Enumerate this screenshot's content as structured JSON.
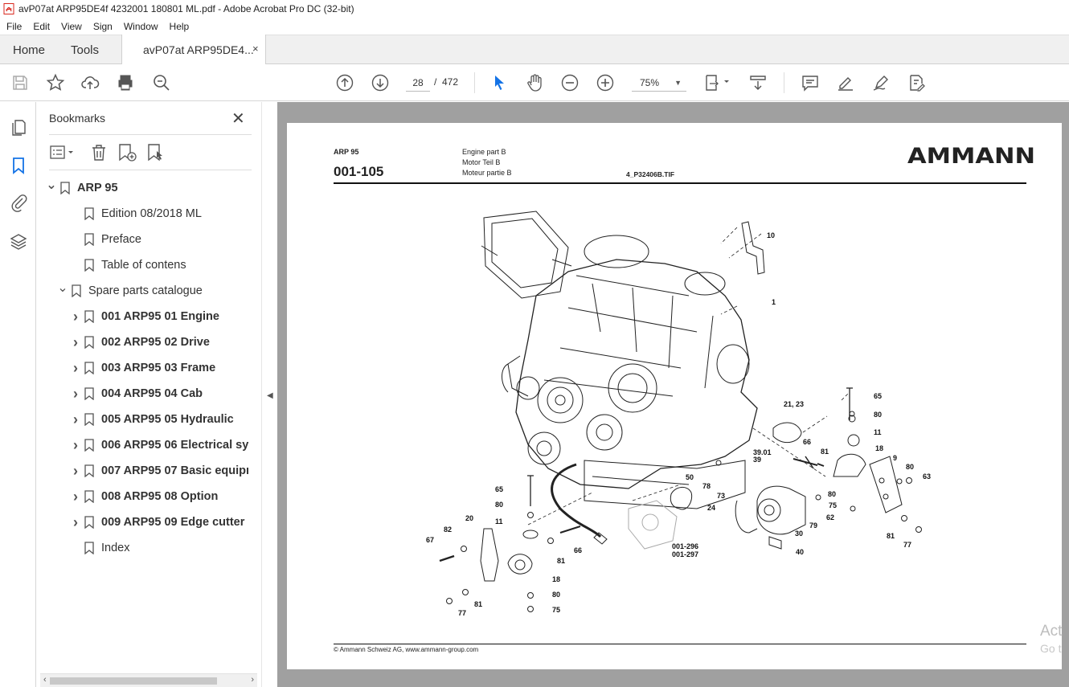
{
  "window": {
    "title": "avP07at ARP95DE4f 4232001 180801 ML.pdf - Adobe Acrobat Pro DC (32-bit)"
  },
  "menu": [
    "File",
    "Edit",
    "View",
    "Sign",
    "Window",
    "Help"
  ],
  "tabs": {
    "home": "Home",
    "tools": "Tools",
    "document": "avP07at ARP95DE4...",
    "close": "×"
  },
  "toolbar": {
    "page_current": "28",
    "page_sep": "/",
    "page_total": "472",
    "zoom": "75%"
  },
  "bookmarks": {
    "title": "Bookmarks",
    "close": "✕",
    "items": [
      {
        "label": "ARP 95",
        "arrow": "expanded"
      },
      {
        "label": "Edition 08/2018 ML"
      },
      {
        "label": "Preface"
      },
      {
        "label": "Table of contens"
      },
      {
        "label": "Spare parts catalogue",
        "arrow": "expanded"
      },
      {
        "label": "001 ARP95 01 Engine",
        "arrow": "collapsed"
      },
      {
        "label": "002 ARP95 02 Drive",
        "arrow": "collapsed"
      },
      {
        "label": "003 ARP95 03 Frame",
        "arrow": "collapsed"
      },
      {
        "label": "004 ARP95 04 Cab",
        "arrow": "collapsed"
      },
      {
        "label": "005 ARP95 05 Hydraulic",
        "arrow": "collapsed"
      },
      {
        "label": "006 ARP95 06 Electrical sy",
        "arrow": "collapsed"
      },
      {
        "label": "007 ARP95 07 Basic equipı",
        "arrow": "collapsed"
      },
      {
        "label": "008 ARP95 08 Option",
        "arrow": "collapsed"
      },
      {
        "label": "009 ARP95 09 Edge cutter",
        "arrow": "collapsed"
      },
      {
        "label": "Index"
      }
    ]
  },
  "document": {
    "model": "ARP 95",
    "section": "001-105",
    "desc_en": "Engine part B",
    "desc_de": "Motor Teil B",
    "desc_fr": "Moteur partie B",
    "file": "4_P32406B.TIF",
    "logo": "AMMANN",
    "copyright": "© Ammann Schweiz AG, www.ammann-group.com",
    "callouts": [
      "10",
      "1",
      "65",
      "80",
      "11",
      "18",
      "21, 23",
      "9",
      "80",
      "63",
      "66",
      "81",
      "39.01",
      "39",
      "50",
      "78",
      "73",
      "24",
      "80",
      "75",
      "62",
      "79",
      "30",
      "40",
      "81",
      "77",
      "65",
      "80",
      "11",
      "20",
      "82",
      "67",
      "81",
      "66",
      "18",
      "80",
      "75",
      "81",
      "77",
      "001-296",
      "001-297"
    ]
  },
  "watermark": {
    "line1": "Act",
    "line2": "Go t"
  }
}
